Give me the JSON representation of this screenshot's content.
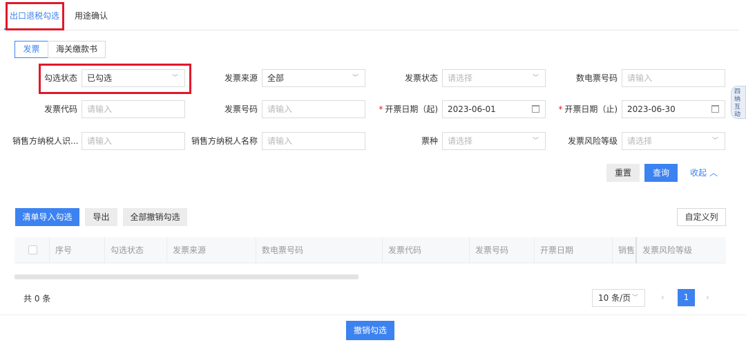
{
  "tabs": [
    {
      "label": "出口退税勾选",
      "active": true
    },
    {
      "label": "用途确认",
      "active": false
    }
  ],
  "subtabs": [
    {
      "label": "发票",
      "active": true
    },
    {
      "label": "海关缴款书",
      "active": false
    }
  ],
  "filters": {
    "select_status": {
      "label": "勾选状态",
      "value": "已勾选"
    },
    "invoice_source": {
      "label": "发票来源",
      "value": "全部"
    },
    "invoice_state": {
      "label": "发票状态",
      "placeholder": "请选择"
    },
    "digital_number": {
      "label": "数电票号码",
      "placeholder": "请输入"
    },
    "invoice_code": {
      "label": "发票代码",
      "placeholder": "请输入"
    },
    "invoice_number": {
      "label": "发票号码",
      "placeholder": "请输入"
    },
    "date_start": {
      "label": "开票日期（起)",
      "value": "2023-06-01",
      "required_mark": "*"
    },
    "date_end": {
      "label": "开票日期（止)",
      "value": "2023-06-30",
      "required_mark": "*"
    },
    "seller_taxid": {
      "label": "销售方纳税人识...",
      "placeholder": "请输入"
    },
    "seller_name": {
      "label": "销售方纳税人名称",
      "placeholder": "请输入"
    },
    "ticket_type": {
      "label": "票种",
      "placeholder": "请选择"
    },
    "risk_level": {
      "label": "发票风险等级",
      "placeholder": "请选择"
    }
  },
  "actions": {
    "reset": "重置",
    "search": "查询",
    "collapse": "收起"
  },
  "toolbar": {
    "import_select": "清单导入勾选",
    "export": "导出",
    "cancel_all": "全部撤销勾选",
    "custom_columns": "自定义列"
  },
  "table": {
    "columns": [
      "序号",
      "勾选状态",
      "发票来源",
      "数电票号码",
      "发票代码",
      "发票号码",
      "开票日期",
      "销售方",
      "发票风险等级"
    ]
  },
  "pagination": {
    "total": "共 0 条",
    "page_size": "10 条/页",
    "current_page": "1",
    "prev": "‹",
    "next": "›"
  },
  "footer": {
    "cancel_select": "撤销勾选"
  },
  "side_widget": {
    "text": "四 纳 互 动"
  },
  "colors": {
    "accent": "#3c82f0",
    "highlight": "#e0182b"
  }
}
